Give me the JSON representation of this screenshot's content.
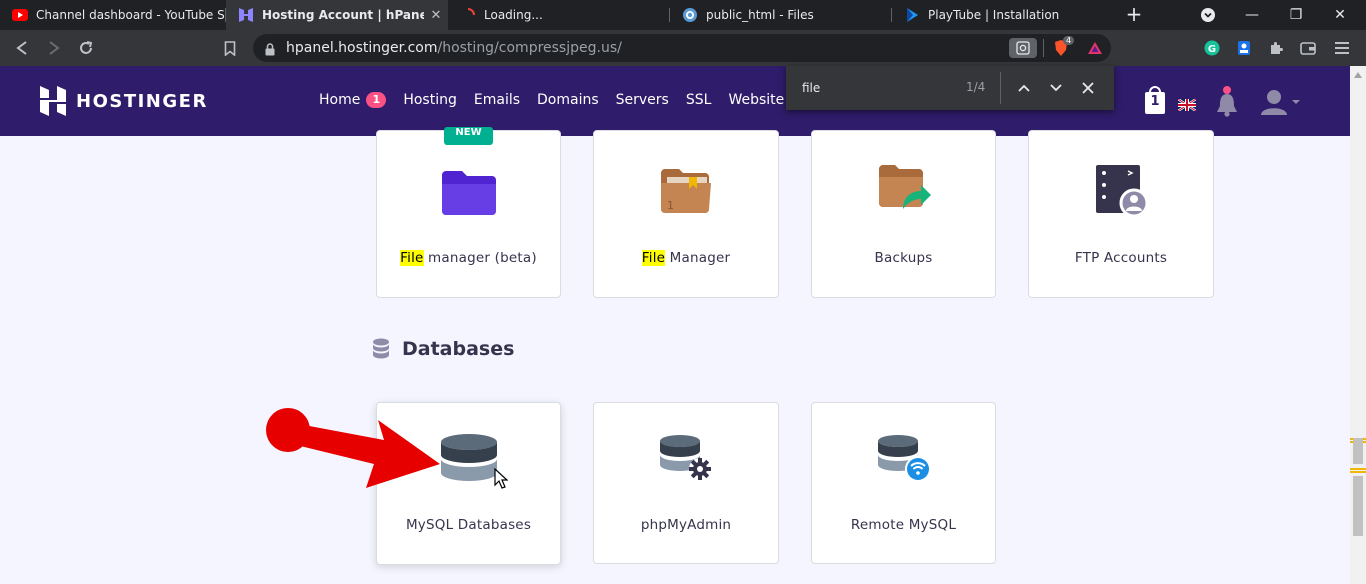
{
  "tabs": [
    {
      "title": "Channel dashboard - YouTube Studio",
      "favicon": "youtube-icon",
      "active": false
    },
    {
      "title": "Hosting Account | hPanel",
      "favicon": "hostinger-icon",
      "active": true
    },
    {
      "title": "Loading...",
      "favicon": "loading-spinner-icon",
      "active": false
    },
    {
      "title": "public_html - Files",
      "favicon": "files-icon",
      "active": false
    },
    {
      "title": "PlayTube | Installation",
      "favicon": "playtube-icon",
      "active": false
    }
  ],
  "address_bar": {
    "host": "hpanel.hostinger.com",
    "path": "/hosting/compressjpeg.us/"
  },
  "extensions": {
    "brave_count": "4"
  },
  "header": {
    "logo": "HOSTINGER",
    "nav": [
      {
        "label": "Home",
        "badge": "1"
      },
      {
        "label": "Hosting"
      },
      {
        "label": "Emails"
      },
      {
        "label": "Domains"
      },
      {
        "label": "Servers"
      },
      {
        "label": "SSL"
      },
      {
        "label": "Website builder"
      }
    ],
    "cart_count": "1"
  },
  "findbar": {
    "query": "file",
    "count": "1/4"
  },
  "files_cards": [
    {
      "label_highlight": "File",
      "label_rest": " manager (beta)",
      "tag": "NEW"
    },
    {
      "label_highlight": "File",
      "label_rest": " Manager"
    },
    {
      "label": "Backups"
    },
    {
      "label": "FTP Accounts"
    }
  ],
  "databases": {
    "title": "Databases",
    "cards": [
      {
        "label": "MySQL Databases"
      },
      {
        "label": "phpMyAdmin"
      },
      {
        "label": "Remote MySQL"
      }
    ]
  },
  "colors": {
    "header_bg": "#2f1c6a",
    "page_bg": "#f4f5ff",
    "badge": "#fc5185",
    "new_tag": "#00b090",
    "highlight": "#ffff00",
    "arrow": "#e60000"
  }
}
